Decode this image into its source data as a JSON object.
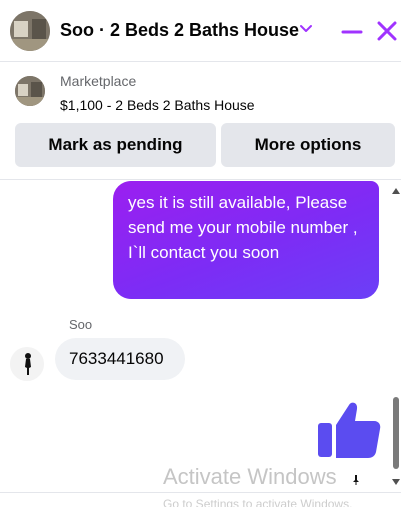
{
  "header": {
    "title": "Soo · 2 Beds 2 Baths House",
    "icons": {
      "dropdown": "chevron-down-icon",
      "minimize": "minimize-icon",
      "close": "close-icon"
    },
    "accent_color": "#a033ff"
  },
  "listing": {
    "source_label": "Marketplace",
    "title": "$1,100 - 2 Beds 2 Baths House"
  },
  "actions": {
    "pending_label": "Mark as pending",
    "more_label": "More options"
  },
  "messages": [
    {
      "from": "me",
      "text": "yes it is still available, Please send me your mobile number , I`ll contact  you soon"
    },
    {
      "from": "Soo",
      "text": "7633441680"
    }
  ],
  "sender_name": "Soo",
  "reaction_icon": "thumbs-up-icon",
  "watermark": {
    "line1": "Activate Windows",
    "line2": "Go to Settings to activate Windows."
  },
  "colors": {
    "outgoing_bubble_start": "#9b1ff0",
    "outgoing_bubble_end": "#6b3ff7",
    "incoming_bubble": "#f0f2f5",
    "button_bg": "#e4e6eb",
    "thumb": "#5b4cf0"
  }
}
